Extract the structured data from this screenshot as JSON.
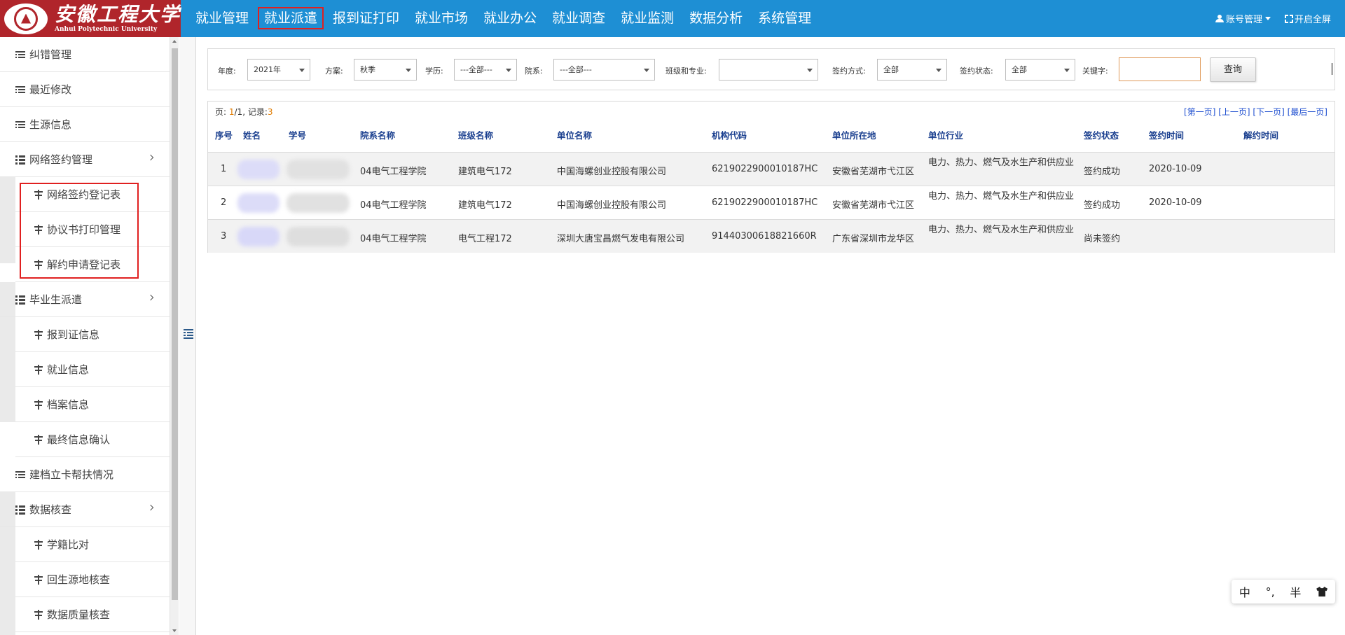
{
  "header": {
    "logo_cn": "安徽工程大学",
    "logo_en": "Anhui Polytechnic University",
    "nav": [
      "就业管理",
      "就业派遣",
      "报到证打印",
      "就业市场",
      "就业办公",
      "就业调查",
      "就业监测",
      "数据分析",
      "系统管理"
    ],
    "active_nav": "就业派遣",
    "account_label": "账号管理",
    "fullscreen_label": "开启全屏"
  },
  "sidebar": {
    "items": [
      {
        "label": "纠错管理",
        "type": "top",
        "icon": "list-icon"
      },
      {
        "label": "最近修改",
        "type": "top",
        "icon": "list-icon"
      },
      {
        "label": "生源信息",
        "type": "top",
        "icon": "list-icon"
      },
      {
        "label": "网络签约管理",
        "type": "group",
        "icon": "th-list-icon"
      },
      {
        "label": "网络签约登记表",
        "type": "sub",
        "icon": "split-icon"
      },
      {
        "label": "协议书打印管理",
        "type": "sub",
        "icon": "split-icon"
      },
      {
        "label": "解约申请登记表",
        "type": "sub",
        "icon": "split-icon"
      },
      {
        "label": "毕业生派遣",
        "type": "group",
        "icon": "th-list-icon"
      },
      {
        "label": "报到证信息",
        "type": "sub",
        "icon": "split-icon"
      },
      {
        "label": "就业信息",
        "type": "sub",
        "icon": "split-icon"
      },
      {
        "label": "档案信息",
        "type": "sub",
        "icon": "split-icon"
      },
      {
        "label": "最终信息确认",
        "type": "sub",
        "icon": "split-icon"
      },
      {
        "label": "建档立卡帮扶情况",
        "type": "top",
        "icon": "list-icon"
      },
      {
        "label": "数据核查",
        "type": "group",
        "icon": "th-list-icon"
      },
      {
        "label": "学籍比对",
        "type": "sub",
        "icon": "split-icon"
      },
      {
        "label": "回生源地核查",
        "type": "sub",
        "icon": "split-icon"
      },
      {
        "label": "数据质量核查",
        "type": "sub",
        "icon": "split-icon"
      }
    ]
  },
  "filters": {
    "year_label": "年度:",
    "year_value": "2021年",
    "plan_label": "方案:",
    "plan_value": "秋季",
    "edu_label": "学历:",
    "edu_value": "---全部---",
    "dept_label": "院系:",
    "dept_value": "---全部---",
    "class_label": "班级和专业:",
    "class_value": "",
    "sign_method_label": "签约方式:",
    "sign_method_value": "全部",
    "sign_status_label": "签约状态:",
    "sign_status_value": "全部",
    "keyword_label": "关键字:",
    "keyword_value": "",
    "query_button": "查询"
  },
  "grid": {
    "page_prefix": "页:",
    "page_current": "1",
    "page_sep": "/1,",
    "records_label": "记录:",
    "records_count": "3",
    "pager": [
      "[第一页]",
      "[上一页]",
      "[下一页]",
      "[最后一页]"
    ],
    "columns": [
      "序号",
      "姓名",
      "学号",
      "院系名称",
      "班级名称",
      "单位名称",
      "机构代码",
      "单位所在地",
      "单位行业",
      "签约状态",
      "签约时间",
      "解约时间"
    ],
    "rows": [
      {
        "no": "1",
        "dept": "04电气工程学院",
        "class": "建筑电气172",
        "company": "中国海螺创业控股有限公司",
        "code": "6219022900010187HC",
        "location": "安徽省芜湖市弋江区",
        "industry": "电力、热力、燃气及水生产和供应业",
        "status": "签约成功",
        "sign_date": "2020-10-09",
        "cancel_date": ""
      },
      {
        "no": "2",
        "dept": "04电气工程学院",
        "class": "建筑电气172",
        "company": "中国海螺创业控股有限公司",
        "code": "6219022900010187HC",
        "location": "安徽省芜湖市弋江区",
        "industry": "电力、热力、燃气及水生产和供应业",
        "status": "签约成功",
        "sign_date": "2020-10-09",
        "cancel_date": ""
      },
      {
        "no": "3",
        "dept": "04电气工程学院",
        "class": "电气工程172",
        "company": "深圳大唐宝昌燃气发电有限公司",
        "code": "91440300618821660R",
        "location": "广东省深圳市龙华区",
        "industry": "电力、热力、燃气及水生产和供应业",
        "status": "尚未签约",
        "sign_date": "",
        "cancel_date": ""
      }
    ]
  },
  "ime": {
    "lang": "中",
    "punct": "°,",
    "width": "半"
  }
}
